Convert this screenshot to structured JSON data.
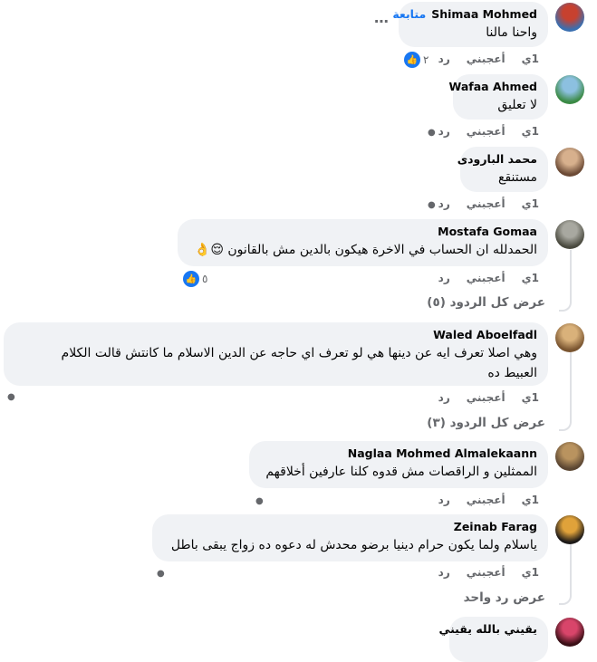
{
  "actions": {
    "time": "1ي",
    "like": "أعجبني",
    "reply": "رد"
  },
  "follow_label": "متابعة",
  "comments": [
    {
      "name": "Shimaa Mohmed",
      "text": "واحنا مالنا",
      "reactions": "٢",
      "avatar_colors": [
        "#3a6fb0",
        "#c7412f"
      ]
    },
    {
      "name": "Wafaa Ahmed",
      "text": "لا تعليق",
      "avatar_colors": [
        "#3b8a45",
        "#8cc0e0"
      ]
    },
    {
      "name": "محمد البارودى",
      "text": "مستنقع",
      "avatar_colors": [
        "#6b4a35",
        "#d7b08d"
      ]
    },
    {
      "name": "Mostafa Gomaa",
      "text": "الحمدلله ان الحساب في الاخرة هيكون بالدين مش بالقانون 😌👌",
      "reactions": "٥",
      "view_all": "عرض كل الردود (٥)",
      "avatar_colors": [
        "#4a4a3f",
        "#a8a8a0"
      ]
    },
    {
      "name": "Waled Aboelfadl",
      "text_lines": [
        "وهي اصلا تعرف ايه عن دينها هي لو تعرف اي حاجه عن الدين الاسلام ما كانتش قالت الكلام",
        "العبيط ده"
      ],
      "view_all": "عرض كل الردود (٣)",
      "avatar_colors": [
        "#7a5530",
        "#d9b17a"
      ]
    },
    {
      "name": "Naglaa Mohmed Almalekaann",
      "text": "الممثلين و الراقصات مش قدوه كلنا عارفين أخلاقهم",
      "avatar_colors": [
        "#5b4632",
        "#b9935f"
      ]
    },
    {
      "name": "Zeinab Farag",
      "text": "ياسلام ولما يكون حرام دينيا برضو محدش له دعوه ده زواج يبقى باطل",
      "view_all": "عرض رد واحد",
      "avatar_colors": [
        "#1d1a18",
        "#e0a23a"
      ]
    },
    {
      "name": "يقيني بالله يقيني",
      "avatar_colors": [
        "#3a0f16",
        "#d8456a"
      ]
    }
  ]
}
